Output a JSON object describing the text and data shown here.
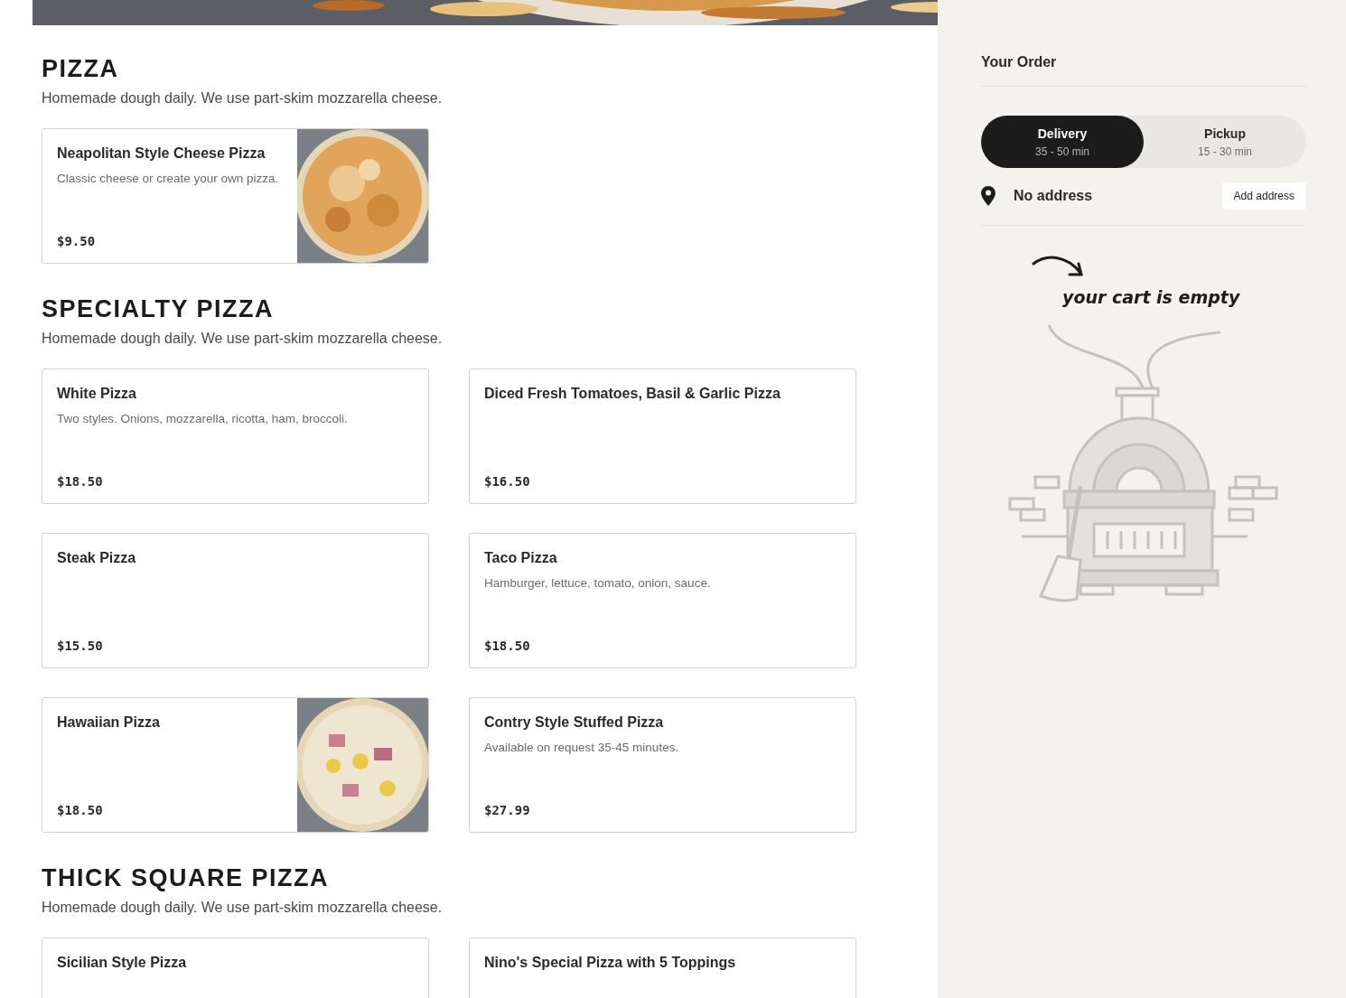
{
  "sections": [
    {
      "title": "PIZZA",
      "description": "Homemade dough daily. We use part-skim mozzarella cheese.",
      "items": [
        {
          "name": "Neapolitan Style Cheese Pizza",
          "description": "Classic cheese or create your own pizza.",
          "price": "$9.50"
        }
      ]
    },
    {
      "title": "SPECIALTY PIZZA",
      "description": "Homemade dough daily. We use part-skim mozzarella cheese.",
      "items": [
        {
          "name": "White Pizza",
          "description": "Two styles. Onions, mozzarella, ricotta, ham, broccoli.",
          "price": "$18.50"
        },
        {
          "name": "Diced Fresh Tomatoes, Basil & Garlic Pizza",
          "price": "$16.50"
        },
        {
          "name": "Steak Pizza",
          "price": "$15.50"
        },
        {
          "name": "Taco Pizza",
          "description": "Hamburger, lettuce, tomato, onion, sauce.",
          "price": "$18.50"
        },
        {
          "name": "Hawaiian Pizza",
          "price": "$18.50"
        },
        {
          "name": "Contry Style Stuffed Pizza",
          "description": "Available on request 35-45 minutes.",
          "price": "$27.99"
        }
      ]
    },
    {
      "title": "THICK SQUARE PIZZA",
      "description": "Homemade dough daily. We use part-skim mozzarella cheese.",
      "items": [
        {
          "name": "Sicilian Style Pizza"
        },
        {
          "name": "Nino's Special Pizza with 5 Toppings"
        }
      ]
    }
  ],
  "order": {
    "title": "Your Order",
    "modes": [
      {
        "label": "Delivery",
        "time": "35 - 50 min",
        "selected": true
      },
      {
        "label": "Pickup",
        "time": "15 - 30 min",
        "selected": false
      }
    ],
    "address": "No address",
    "add_address_button": "Add address",
    "empty_message": "your cart is empty"
  }
}
